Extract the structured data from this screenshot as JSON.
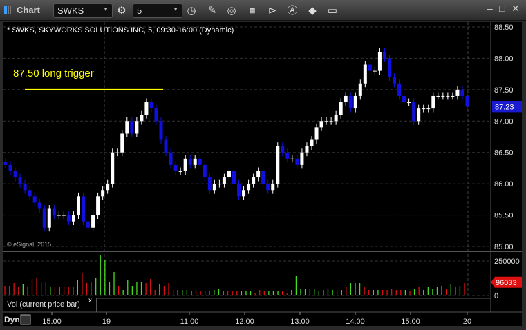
{
  "toolbar": {
    "title": "Chart",
    "symbol": "SWKS",
    "interval": "5"
  },
  "chart_header": "* SWKS, SKYWORKS SOLUTIONS INC, 5, 09:30-16:00 (Dynamic)",
  "annotation": "87.50 long trigger",
  "copyright": "© eSignal, 2015",
  "volume_panel": {
    "label": "Vol (current price bar)",
    "close": "x",
    "current": "96033",
    "ticks": [
      "250000",
      "0"
    ]
  },
  "footer": {
    "mode": "Dyn"
  },
  "colors": {
    "up": "#ffffff",
    "down": "#1010e0",
    "vol_up": "#44dd22",
    "vol_down": "#dd1111",
    "trigger": "#ffff00",
    "last": "#dd1111"
  },
  "chart_data": {
    "type": "candlestick",
    "y_ticks": [
      "88.50",
      "88.00",
      "87.50",
      "87.00",
      "86.50",
      "86.00",
      "85.50",
      "85.00"
    ],
    "ylim": [
      85.0,
      88.5
    ],
    "last_price": "87.23",
    "trigger_level": 87.5,
    "x_ticks": [
      "15:00",
      "19",
      "11:00",
      "12:00",
      "13:00",
      "14:00",
      "15:00",
      "20"
    ],
    "open_first": 86.35,
    "closes": [
      86.3,
      86.2,
      86.1,
      86.0,
      85.9,
      85.8,
      85.7,
      85.6,
      85.3,
      85.6,
      85.5,
      85.5,
      85.5,
      85.4,
      85.5,
      85.8,
      85.4,
      85.3,
      85.5,
      85.8,
      85.9,
      86.0,
      86.5,
      86.5,
      86.8,
      87.0,
      86.8,
      87.0,
      87.1,
      87.3,
      87.2,
      87.0,
      86.7,
      86.5,
      86.3,
      86.2,
      86.2,
      86.4,
      86.3,
      86.4,
      86.3,
      86.1,
      85.9,
      86.0,
      86.0,
      86.1,
      86.2,
      86.0,
      85.8,
      85.9,
      86.0,
      86.1,
      86.2,
      86.0,
      85.9,
      86.0,
      86.6,
      86.5,
      86.4,
      86.4,
      86.3,
      86.5,
      86.6,
      86.7,
      86.9,
      87.0,
      87.0,
      87.0,
      87.1,
      87.3,
      87.4,
      87.2,
      87.4,
      87.6,
      87.9,
      87.8,
      87.8,
      88.1,
      88.0,
      87.7,
      87.6,
      87.4,
      87.3,
      87.3,
      87.0,
      87.2,
      87.2,
      87.2,
      87.4,
      87.4,
      87.4,
      87.4,
      87.4,
      87.5,
      87.4,
      87.23
    ],
    "volumes": [
      70,
      70,
      90,
      60,
      80,
      60,
      120,
      130,
      100,
      100,
      60,
      60,
      60,
      60,
      60,
      60,
      110,
      160,
      90,
      100,
      130,
      290,
      260,
      100,
      170,
      70,
      40,
      110,
      70,
      100,
      100,
      90,
      120,
      40,
      80,
      70,
      90,
      40,
      40,
      40,
      40,
      30,
      40,
      30,
      30,
      30,
      40,
      50,
      30,
      30,
      30,
      30,
      30,
      30,
      30,
      20,
      40,
      30,
      30,
      30,
      30,
      30,
      20,
      40,
      140,
      50,
      50,
      50,
      50,
      30,
      40,
      50,
      40,
      40,
      40,
      60,
      90,
      90,
      90,
      60,
      40,
      40,
      40,
      40,
      40,
      50,
      40,
      40,
      40,
      30,
      50,
      60,
      40,
      60,
      50,
      60,
      70,
      50,
      80,
      60,
      70,
      90
    ]
  }
}
